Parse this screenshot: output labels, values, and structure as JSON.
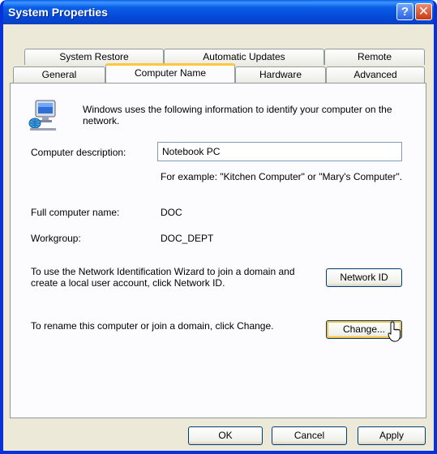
{
  "window": {
    "title": "System Properties"
  },
  "titlebar": {
    "help_symbol": "?",
    "close_symbol": "✕"
  },
  "tabs": {
    "row_back": [
      {
        "label": "System Restore"
      },
      {
        "label": "Automatic Updates"
      },
      {
        "label": "Remote"
      }
    ],
    "row_front": [
      {
        "label": "General"
      },
      {
        "label": "Computer Name",
        "active": true
      },
      {
        "label": "Hardware"
      },
      {
        "label": "Advanced"
      }
    ]
  },
  "panel": {
    "intro": "Windows uses the following information to identify your computer on the network.",
    "description_label": "Computer description:",
    "description_value": "Notebook PC",
    "example_text": "For example: \"Kitchen Computer\" or \"Mary's Computer\".",
    "full_name_label": "Full computer name:",
    "full_name_value": "DOC",
    "workgroup_label": "Workgroup:",
    "workgroup_value": "DOC_DEPT",
    "network_id_text": "To use the Network Identification Wizard to join a domain and create a local user account, click Network ID.",
    "network_id_button": "Network ID",
    "rename_text": "To rename this computer or join a domain, click Change.",
    "change_button": "Change..."
  },
  "footer": {
    "ok_button": "OK",
    "cancel_button": "Cancel",
    "apply_button": "Apply"
  },
  "icons": {
    "computer": "computer-network-icon",
    "cursor": "mouse-pointer-icon"
  }
}
